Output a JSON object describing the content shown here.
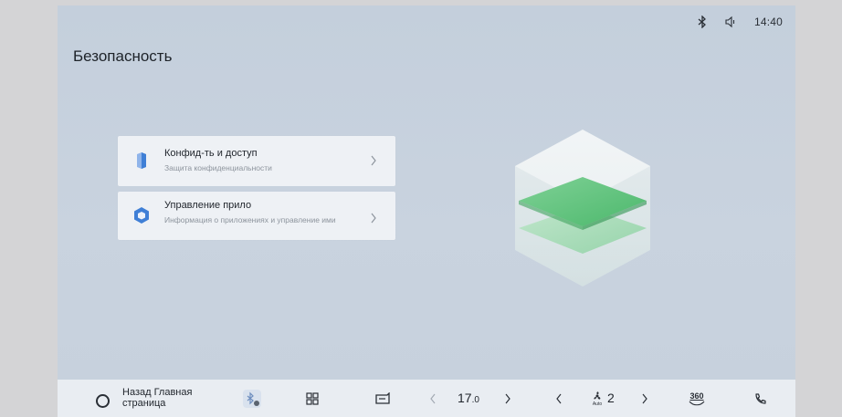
{
  "status": {
    "time": "14:40"
  },
  "page": {
    "title": "Безопасность"
  },
  "cards": [
    {
      "title": "Конфид-ть и доступ",
      "subtitle": "Защита конфиденциальности"
    },
    {
      "title": "Управление прило",
      "subtitle": "Информация о приложениях и управление ими"
    }
  ],
  "dock": {
    "back_label": "Назад Главная страница",
    "temperature_main": "17",
    "temperature_decimal": ".0",
    "fan_level": "2",
    "fan_mode": "Auto",
    "view_label": "360"
  },
  "colors": {
    "accent_green": "#5fc27a",
    "icon_blue": "#3f7fd6"
  }
}
